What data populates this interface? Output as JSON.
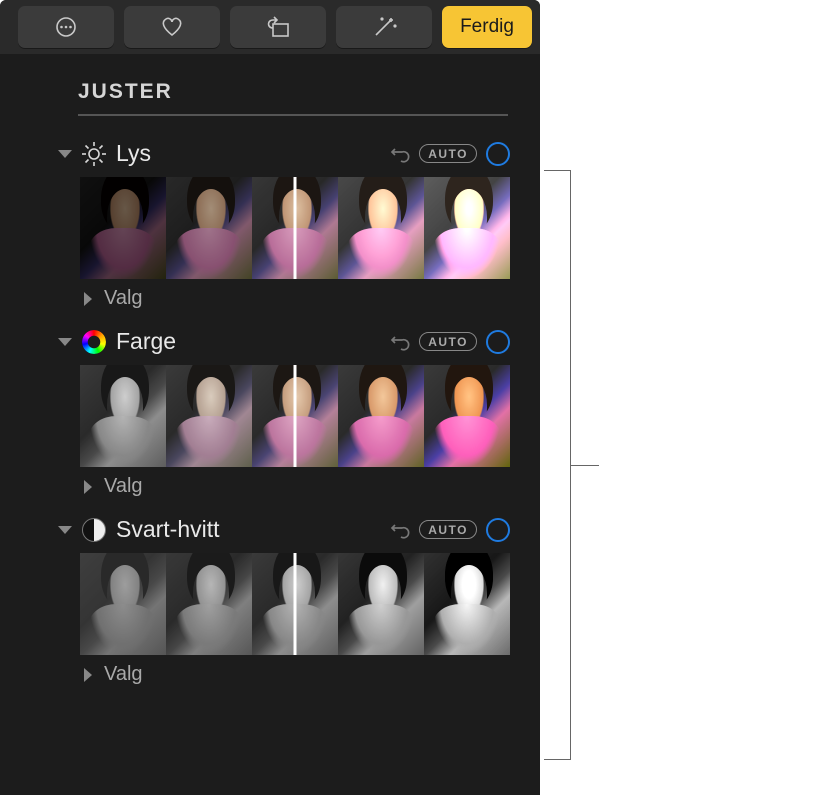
{
  "toolbar": {
    "done_label": "Ferdig"
  },
  "adjust": {
    "section_title": "Juster",
    "auto_label": "AUTO",
    "light": {
      "label": "Lys",
      "options_label": "Valg"
    },
    "color": {
      "label": "Farge",
      "options_label": "Valg"
    },
    "bw": {
      "label": "Svart-hvitt",
      "options_label": "Valg"
    }
  }
}
